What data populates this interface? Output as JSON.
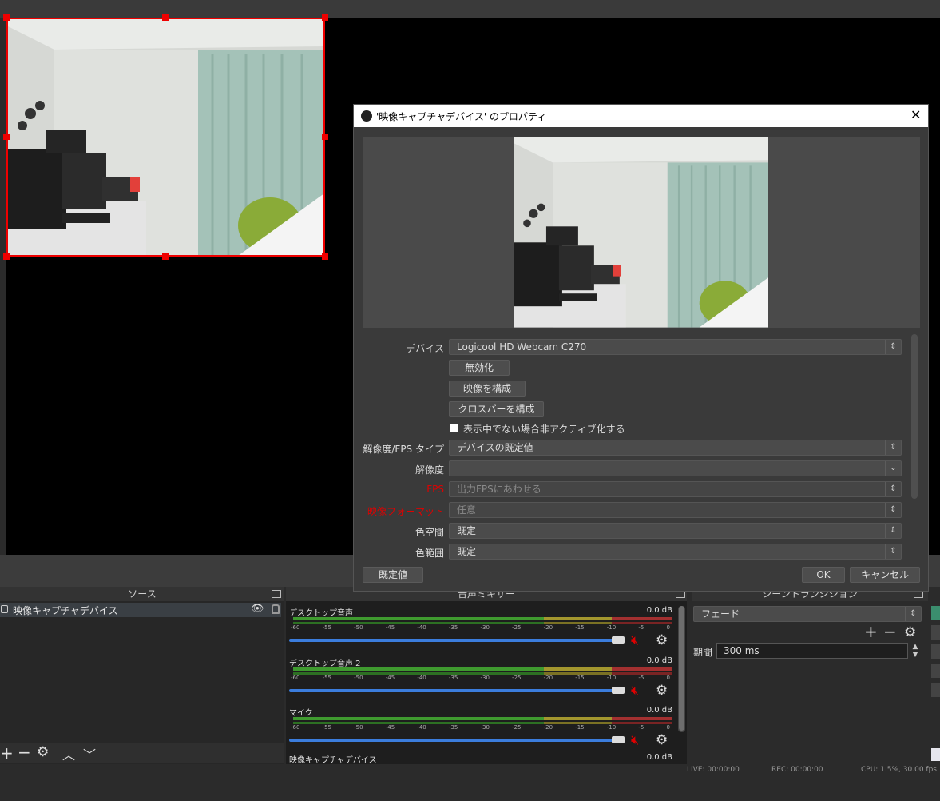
{
  "dialog": {
    "title": "'映像キャプチャデバイス' のプロパティ",
    "fields": {
      "device": {
        "label": "デバイス",
        "value": "Logicool HD Webcam C270"
      },
      "res_fps_type": {
        "label": "解像度/FPS タイプ",
        "value": "デバイスの既定値"
      },
      "resolution": {
        "label": "解像度",
        "value": ""
      },
      "fps": {
        "label": "FPS",
        "value": "出力FPSにあわせる"
      },
      "video_format": {
        "label": "映像フォーマット",
        "value": "任意"
      },
      "color_space": {
        "label": "色空間",
        "value": "既定"
      },
      "color_range": {
        "label": "色範囲",
        "value": "既定"
      }
    },
    "buttons": {
      "deactivate": "無効化",
      "configure_video": "映像を構成",
      "configure_crossbar": "クロスバーを構成",
      "defaults": "既定値",
      "ok": "OK",
      "cancel": "キャンセル"
    },
    "checkbox": {
      "label": "表示中でない場合非アクティブ化する",
      "checked": false
    }
  },
  "sources": {
    "title": "ソース",
    "items": [
      {
        "label": "映像キャプチャデバイス",
        "visible": true,
        "locked": false
      }
    ]
  },
  "mixer": {
    "title": "音声ミキサー",
    "scale": [
      "-60",
      "-55",
      "-50",
      "-45",
      "-40",
      "-35",
      "-30",
      "-25",
      "-20",
      "-15",
      "-10",
      "-5",
      "0"
    ],
    "channels": [
      {
        "name": "デスクトップ音声",
        "db": "0.0 dB"
      },
      {
        "name": "デスクトップ音声 2",
        "db": "0.0 dB"
      },
      {
        "name": "マイク",
        "db": "0.0 dB"
      },
      {
        "name": "映像キャプチャデバイス",
        "db": "0.0 dB"
      }
    ]
  },
  "transitions": {
    "title": "シーントランジション",
    "type": "フェード",
    "duration_label": "期間",
    "duration_value": "300 ms"
  },
  "status": {
    "live": "LIVE: 00:00:00",
    "rec": "REC: 00:00:00",
    "cpu": "CPU: 1.5%, 30.00 fps"
  },
  "colors": {
    "accent_red": "#e00000",
    "fader_blue": "#3b7ddd",
    "meter_green": "#3f9a2f",
    "meter_yellow": "#a3972e",
    "meter_red": "#a33030"
  }
}
